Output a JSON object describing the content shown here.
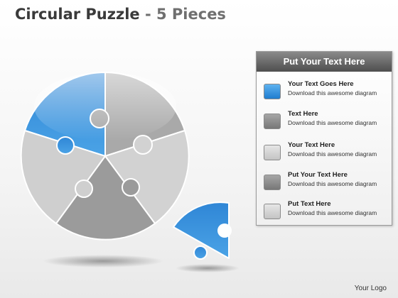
{
  "title": {
    "main": "Circular Puzzle",
    "separator": "-",
    "sub": "5 Pieces"
  },
  "colors": {
    "blue": "#3a93dc",
    "gray_dark": "#9a9a9a",
    "gray_mid": "#b4b4b4",
    "gray_light": "#d4d4d4"
  },
  "panel": {
    "header": "Put Your Text Here",
    "items": [
      {
        "title": "Your Text Goes Here",
        "desc": "Download this awesome diagram",
        "color": "#3a93dc"
      },
      {
        "title": "Text  Here",
        "desc": "Download this awesome diagram",
        "color": "#8e8e8e"
      },
      {
        "title": "Your Text  Here",
        "desc": "Download this awesome diagram",
        "color": "#d6d6d6"
      },
      {
        "title": "Put Your Text Here",
        "desc": "Download this awesome diagram",
        "color": "#8e8e8e"
      },
      {
        "title": "Put Text Here",
        "desc": "Download this awesome diagram",
        "color": "#d6d6d6"
      }
    ]
  },
  "logo": "Your Logo"
}
